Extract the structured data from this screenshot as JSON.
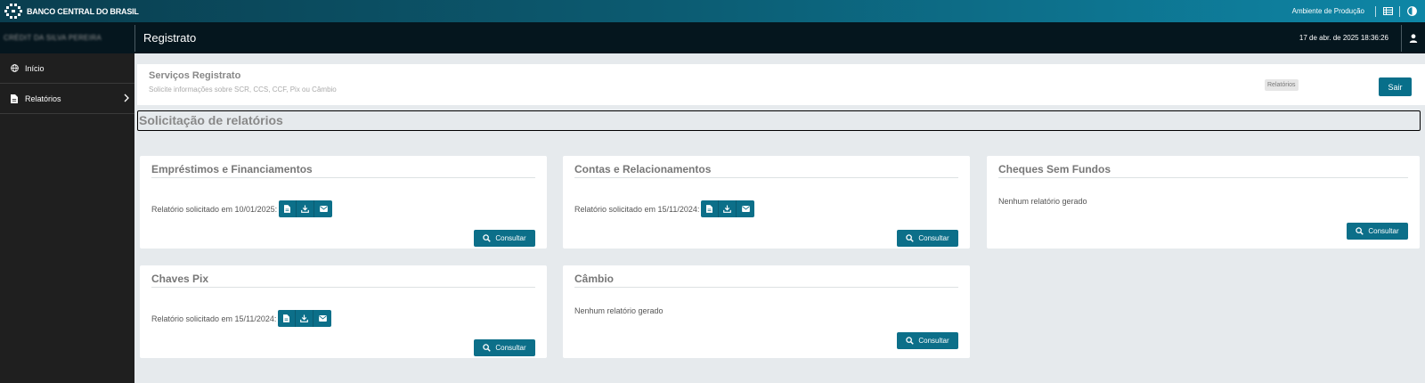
{
  "topbar": {
    "brand": "BANCO CENTRAL DO BRASIL",
    "environment": "Ambiente de Produção"
  },
  "header": {
    "user_name": "CRÉDIT DA SILVA PEREIRA",
    "app_title": "Registrato",
    "datetime": "17 de abr. de 2025 18:36:26"
  },
  "sidebar": {
    "items": [
      {
        "label": "Início",
        "icon": "globe-icon"
      },
      {
        "label": "Relatórios",
        "icon": "document-icon"
      }
    ]
  },
  "service": {
    "title": "Serviços Registrato",
    "subtitle": "Solicite informações sobre SCR, CCS, CCF, Pix ou Câmbio",
    "breadcrumb": "Relatórios",
    "exit_label": "Sair"
  },
  "section_title": "Solicitação de relatórios",
  "cards": [
    {
      "title": "Empréstimos e Financiamentos",
      "text": "Relatório solicitado em 10/01/2025:",
      "button": "Consultar"
    },
    {
      "title": "Contas e Relacionamentos",
      "text": "Relatório solicitado em 15/11/2024:",
      "button": "Consultar"
    },
    {
      "title": "Cheques Sem Fundos",
      "text": "Nenhum relatório gerado",
      "button": "Consultar"
    },
    {
      "title": "Chaves Pix",
      "text": "Relatório solicitado em 15/11/2024:",
      "button": "Consultar"
    },
    {
      "title": "Câmbio",
      "text": "Nenhum relatório gerado",
      "button": "Consultar"
    }
  ],
  "colors": {
    "accent": "#0c6f89",
    "topbar": "#0c5a70",
    "header": "#05161e",
    "sidebar": "#1f1f1f",
    "background": "#e6eaed"
  }
}
